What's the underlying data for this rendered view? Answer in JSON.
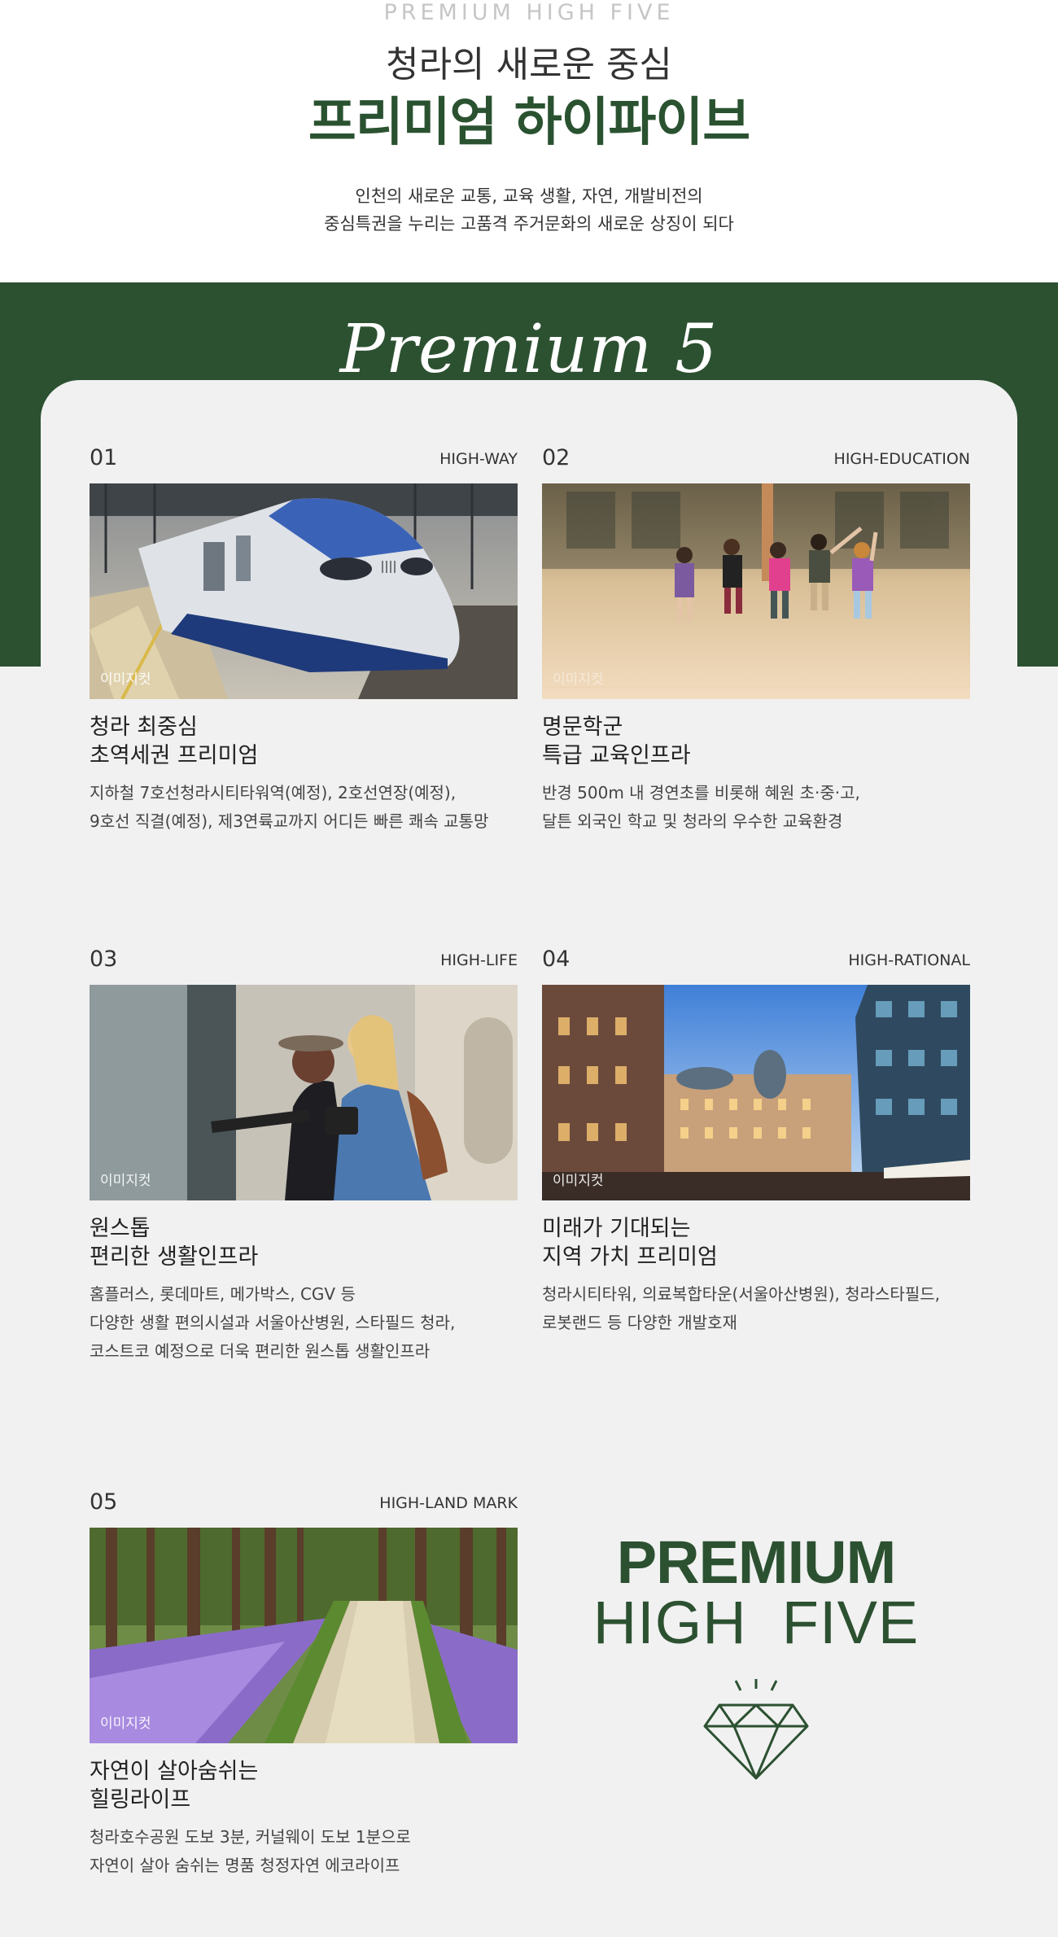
{
  "intro": {
    "eyebrow": "PREMIUM HIGH FIVE",
    "subtitle": "청라의 새로운 중심",
    "title": "프리미엄 하이파이브",
    "desc_line1": "인천의 새로운 교통, 교육 생활, 자연, 개발비전의",
    "desc_line2": "중심특권을 누리는 고품격 주거문화의 새로운 상징이 되다"
  },
  "band": {
    "title": "Premium 5"
  },
  "items": [
    {
      "num": "01",
      "tag": "HIGH-WAY",
      "badge": "이미지컷",
      "head1": "청라 최중심",
      "head2": "초역세권 프리미엄",
      "lines": [
        "지하철 7호선청라시티타워역(예정), 2호선연장(예정),",
        "9호선 직결(예정), 제3연륙교까지 어디든 빠른 쾌속 교통망"
      ],
      "image": "high-speed-train-photo"
    },
    {
      "num": "02",
      "tag": "HIGH-EDUCATION",
      "badge": "이미지컷",
      "head1": "명문학군",
      "head2": "특급 교육인프라",
      "lines": [
        "반경 500m 내 경연초를 비롯해 혜원 초·중·고,",
        "달튼 외국인 학교 및 청라의 우수한 교육환경"
      ],
      "image": "running-children-photo"
    },
    {
      "num": "03",
      "tag": "HIGH-LIFE",
      "badge": "이미지컷",
      "head1": "원스톱",
      "head2": "편리한 생활인프라",
      "lines": [
        "홈플러스, 롯데마트, 메가박스, CGV 등",
        "다양한 생활 편의시설과 서울아산병원, 스타필드 청라,",
        "코스트코 예정으로 더욱 편리한 원스톱 생활인프라"
      ],
      "image": "shopping-women-photo"
    },
    {
      "num": "04",
      "tag": "HIGH-RATIONAL",
      "badge": "이미지컷",
      "head1": "미래가 기대되는",
      "head2": "지역 가치 프리미엄",
      "lines": [
        "청라시티타워, 의료복합타운(서울아산병원), 청라스타필드,",
        "로봇랜드 등 다양한 개발호재"
      ],
      "image": "city-street-photo"
    },
    {
      "num": "05",
      "tag": "HIGH-LAND MARK",
      "badge": "이미지컷",
      "head1": "자연이 살아숨쉬는",
      "head2": "힐링라이프",
      "lines": [
        "청라호수공원 도보 3분, 커널웨이 도보 1분으로",
        "자연이 살아 숨쉬는 명품 청정자연 에코라이프"
      ],
      "image": "forest-path-photo"
    }
  ],
  "logo": {
    "line1": "PREMIUM",
    "line2": "HIGH  FIVE",
    "icon": "diamond-icon"
  },
  "colors": {
    "brand_green": "#2c5131",
    "background_gray": "#f1f1f1"
  }
}
